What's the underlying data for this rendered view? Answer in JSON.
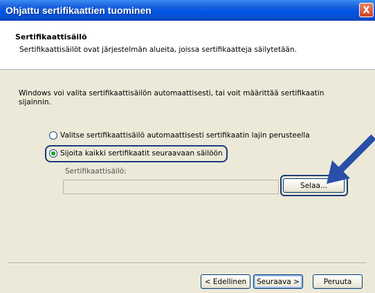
{
  "window": {
    "title": "Ohjattu sertifikaattien tuominen",
    "close_label": "X"
  },
  "header": {
    "title": "Sertifikaattisäilö",
    "subtitle": "Sertifikaattisäilöt ovat järjestelmän alueita, joissa sertifikaatteja säilytetään."
  },
  "body": {
    "description": "Windows voi valita sertifikaattisäilön automaattisesti, tai voit määrittää sertifikaatin sijainnin.",
    "radio_auto": "Valitse sertifikaattisäilö automaattisesti sertifikaatin lajin perusteella",
    "radio_manual": "Sijoita kaikki sertifikaatit seuraavaan säilöön",
    "selected_option": "radio_manual",
    "store_label": "Sertifikaattisäilö:",
    "store_value": "",
    "browse_label": "Selaa..."
  },
  "footer": {
    "back_label": "< Edellinen",
    "next_label": "Seuraava >",
    "cancel_label": "Peruuta"
  },
  "colors": {
    "titlebar": "#0054e3",
    "highlight_outline": "#1c3a7c",
    "arrow": "#2a4fa8",
    "radio_selected": "#21a121"
  },
  "icons": {
    "pointer_arrow": "arrow-icon",
    "close": "close-icon"
  }
}
